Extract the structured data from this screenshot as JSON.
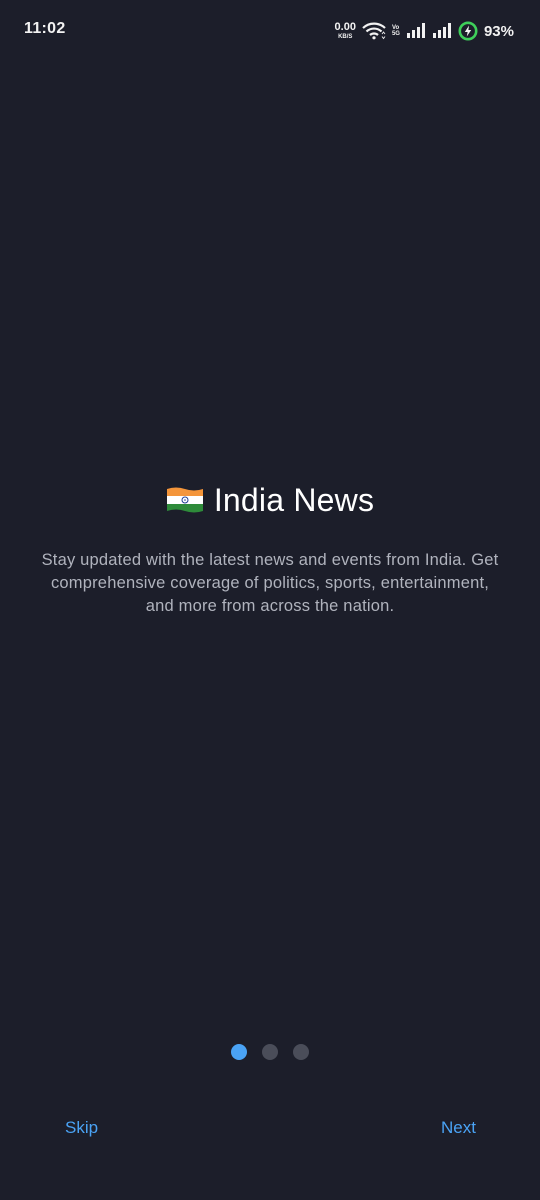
{
  "status_bar": {
    "time": "11:02",
    "net_speed_value": "0.00",
    "net_speed_unit": "KB/S",
    "volte_top": "Vo",
    "volte_bottom": "5G",
    "battery_percent": "93%",
    "icons": [
      "wifi-icon",
      "volte-icon",
      "signal-icon",
      "signal-icon",
      "battery-charging-icon"
    ]
  },
  "onboarding": {
    "flag_icon": "india-flag-icon",
    "title": "India News",
    "description": "Stay updated with the latest news and events from India. Get comprehensive coverage of politics, sports, entertainment, and more from across the nation."
  },
  "pager": {
    "total": 3,
    "active": 1
  },
  "actions": {
    "skip_label": "Skip",
    "next_label": "Next"
  },
  "colors": {
    "background": "#1c1e2a",
    "accent": "#4aa3f5",
    "dot_inactive": "#4a4d59",
    "text_secondary": "#b0b3bd",
    "battery_green": "#3ecf5a"
  }
}
